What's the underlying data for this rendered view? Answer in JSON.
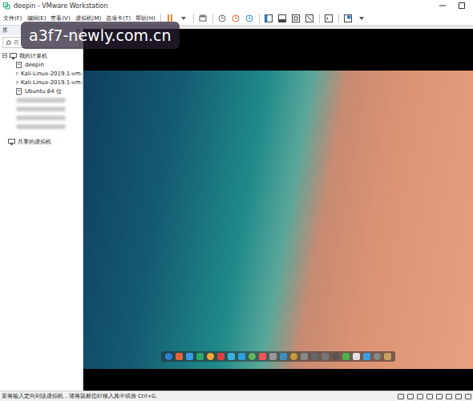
{
  "window": {
    "title": "deepin - VMware Workstation"
  },
  "menu": [
    "文件(F)",
    "编辑(E)",
    "查看(V)",
    "虚拟机(M)",
    "选项卡(T)",
    "帮助(H)"
  ],
  "sidebar": {
    "title": "库",
    "close": "×",
    "search": {
      "placeholder": "在"
    },
    "root": {
      "label": "我的计算机",
      "expanded": true
    },
    "items": [
      {
        "label": "deepin",
        "kind": "vm",
        "selected": false
      },
      {
        "label": "Kali-Linux-2019.1-vm-",
        "kind": "vm",
        "selected": false
      },
      {
        "label": "Kali-Linux-2019.1-vm-",
        "kind": "vm",
        "selected": false
      },
      {
        "label": "Ubuntu 64 位",
        "kind": "vm",
        "selected": false
      },
      {
        "label": "",
        "kind": "redacted",
        "selected": false
      },
      {
        "label": "",
        "kind": "redacted",
        "selected": false
      },
      {
        "label": "",
        "kind": "redacted",
        "selected": false
      },
      {
        "label": "",
        "kind": "redacted",
        "selected": false
      }
    ],
    "shared": "共享的虚拟机"
  },
  "status_bar": {
    "message": "要将输入定向到该虚拟机，请将鼠标指针移入其中或按 Ctrl+G。"
  },
  "watermark": "a3f7-newly.com.cn"
}
